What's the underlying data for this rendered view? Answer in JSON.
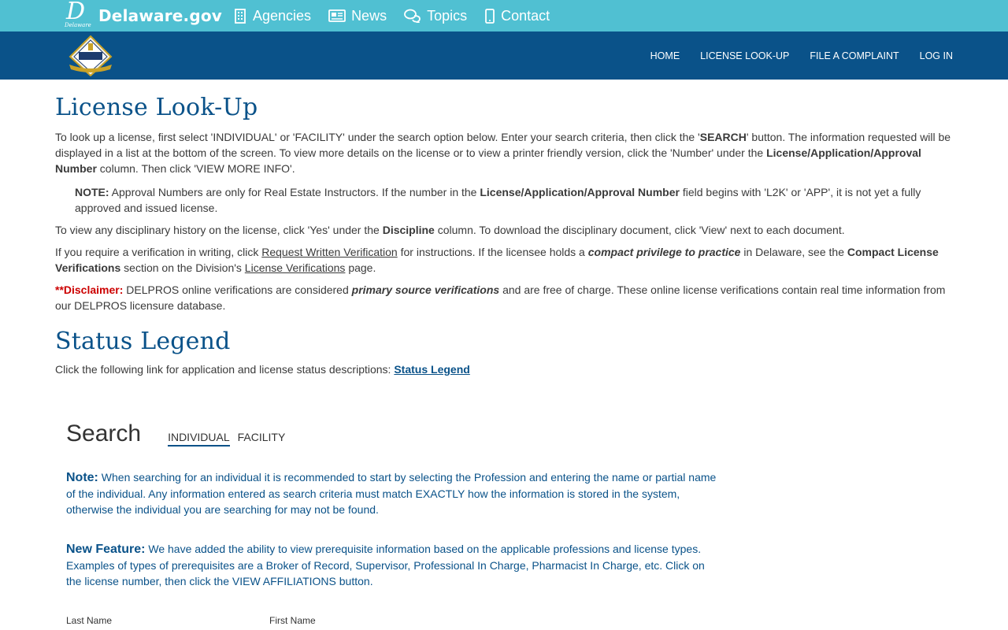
{
  "state_bar": {
    "logo_letter": "D",
    "logo_sub": "Delaware",
    "site_name": "Delaware.gov",
    "nav": [
      {
        "label": "Agencies",
        "icon": "building-icon"
      },
      {
        "label": "News",
        "icon": "newspaper-icon"
      },
      {
        "label": "Topics",
        "icon": "chat-bubbles-icon"
      },
      {
        "label": "Contact",
        "icon": "mobile-phone-icon"
      }
    ]
  },
  "agency_bar": {
    "logo_text": "PROFESSIONAL REGULATION",
    "nav": [
      "HOME",
      "LICENSE LOOK-UP",
      "FILE A COMPLAINT",
      "LOG IN"
    ]
  },
  "content": {
    "title": "License Look-Up",
    "intro": {
      "t1": "To look up a license, first select 'INDIVIDUAL' or 'FACILITY' under the search option below. Enter your search criteria, then click the '",
      "b1": "SEARCH",
      "t2": "' button. The information requested will be displayed in a list at the bottom of the screen. To view more details on the license or to view a printer friendly version, click the 'Number' under the ",
      "b2": "License/Application/Approval Number",
      "t3": " column. Then click 'VIEW MORE INFO'."
    },
    "note": {
      "lead": "NOTE:",
      "t1": " Approval Numbers are only for Real Estate Instructors. If the number in the ",
      "b1": "License/Application/Approval Number",
      "t2": " field begins with 'L2K' or 'APP', it is not yet a fully approved and issued license."
    },
    "discipline": {
      "t1": "To view any disciplinary history on the license, click 'Yes' under the ",
      "b1": "Discipline",
      "t2": " column. To download the disciplinary document, click 'View' next to each document."
    },
    "verification": {
      "t1": "If you require a verification in writing, click ",
      "link1": "Request Written Verification",
      "t2": " for instructions. If the licensee holds a ",
      "bi1": "compact privilege to practice",
      "t3": " in Delaware, see the ",
      "b1": "Compact License Verifications",
      "t4": " section on the Division's ",
      "link2": "License Verifications",
      "t5": " page."
    },
    "disclaimer": {
      "lead": "**Disclaimer:",
      "t1": " DELPROS online verifications are considered ",
      "bi1": "primary source verifications",
      "t2": " and are free of charge. These online license verifications contain real time information from our DELPROS licensure database."
    },
    "status_title": "Status Legend",
    "status_text": "Click the following link for application and license status descriptions: ",
    "status_link": "Status Legend"
  },
  "search": {
    "title": "Search",
    "tabs": [
      "INDIVIDUAL",
      "FACILITY"
    ],
    "note": {
      "lead": "Note:",
      "text": " When searching for an individual it is recommended to start by selecting the Profession and entering the name or partial name of the individual. Any information entered as search criteria must match EXACTLY how the information is stored in the system, otherwise the individual you are searching for may not be found."
    },
    "new_feature": {
      "lead": "New Feature:",
      "text": " We have added the ability to view prerequisite information based on the applicable professions and license types. Examples of types of prerequisites are a Broker of Record, Supervisor, Professional In Charge, Pharmacist In Charge, etc. Click on the license number, then click the VIEW AFFILIATIONS button."
    },
    "fields": {
      "last_name": "Last Name",
      "first_name": "First Name"
    }
  },
  "colors": {
    "state_bar": "#50c0d2",
    "agency_bar": "#0a5289",
    "heading": "#0a5289",
    "disclaimer_red": "#cc0000"
  }
}
